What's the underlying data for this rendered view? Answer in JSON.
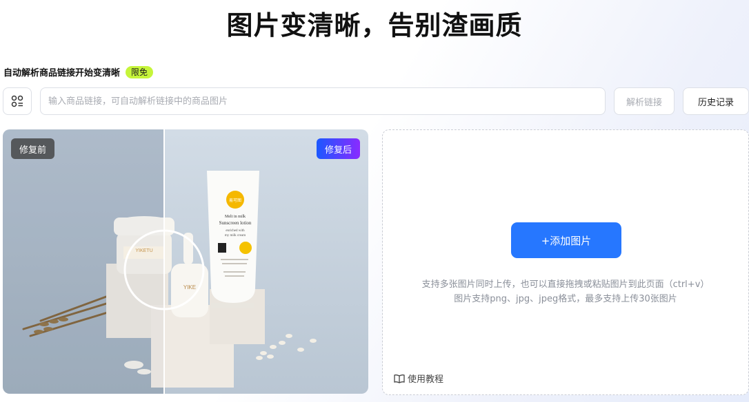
{
  "hero": {
    "title": "图片变清晰，告别渣画质"
  },
  "subheader": {
    "label": "自动解析商品链接开始变清晰",
    "badge": "限免"
  },
  "link_bar": {
    "input_placeholder": "输入商品链接，可自动解析链接中的商品图片",
    "input_value": "",
    "parse_label": "解析链接",
    "history_label": "历史记录"
  },
  "compare": {
    "before_label": "修复前",
    "after_label": "修复后",
    "product_texts": {
      "logo": "易可图",
      "line1": "Melt in milk",
      "line2": "Sunscreen lotion",
      "line3": "enriched with",
      "line4": "my milk cream",
      "jar_brand": "YIKETU",
      "dropper_brand": "YIKE"
    }
  },
  "upload": {
    "add_label": "+添加图片",
    "hint_line1": "支持多张图片同时上传，也可以直接拖拽或粘贴图片到此页面（ctrl+v）",
    "hint_line2": "图片支持png、jpg、jpeg格式，最多支持上传30张图片",
    "tutorial_label": "使用教程"
  },
  "colors": {
    "primary": "#2677ff",
    "badge": "#c6f53a",
    "after_tag_from": "#1b58ff",
    "after_tag_to": "#8a2bff"
  }
}
